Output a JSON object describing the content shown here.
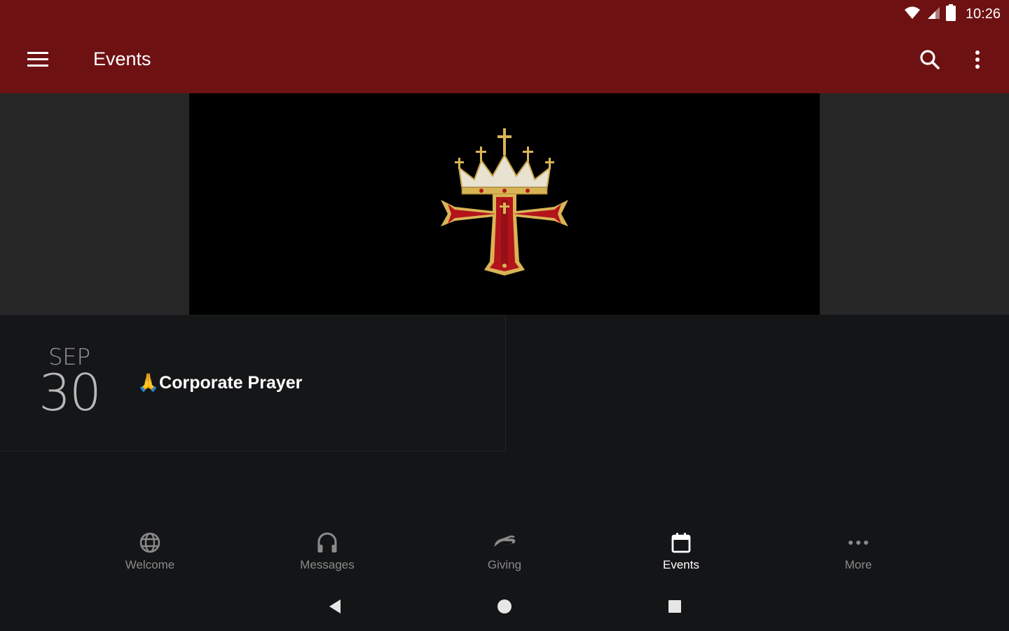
{
  "status_bar": {
    "time": "10:26"
  },
  "appbar": {
    "title": "Events",
    "background": "#6e1113"
  },
  "hero": {
    "image": "cross-crown-emblem"
  },
  "event": {
    "month": "SEP",
    "day": "30",
    "emoji": "🙏",
    "title": "Corporate Prayer"
  },
  "bottom_nav": {
    "items": [
      {
        "label": "Welcome",
        "icon": "globe-icon"
      },
      {
        "label": "Messages",
        "icon": "headphones-icon"
      },
      {
        "label": "Giving",
        "icon": "giving-hand-icon"
      },
      {
        "label": "Events",
        "icon": "calendar-icon",
        "active": true
      },
      {
        "label": "More",
        "icon": "more-dots-icon"
      }
    ]
  },
  "system_nav": {
    "buttons": [
      "back",
      "home",
      "recents"
    ]
  }
}
